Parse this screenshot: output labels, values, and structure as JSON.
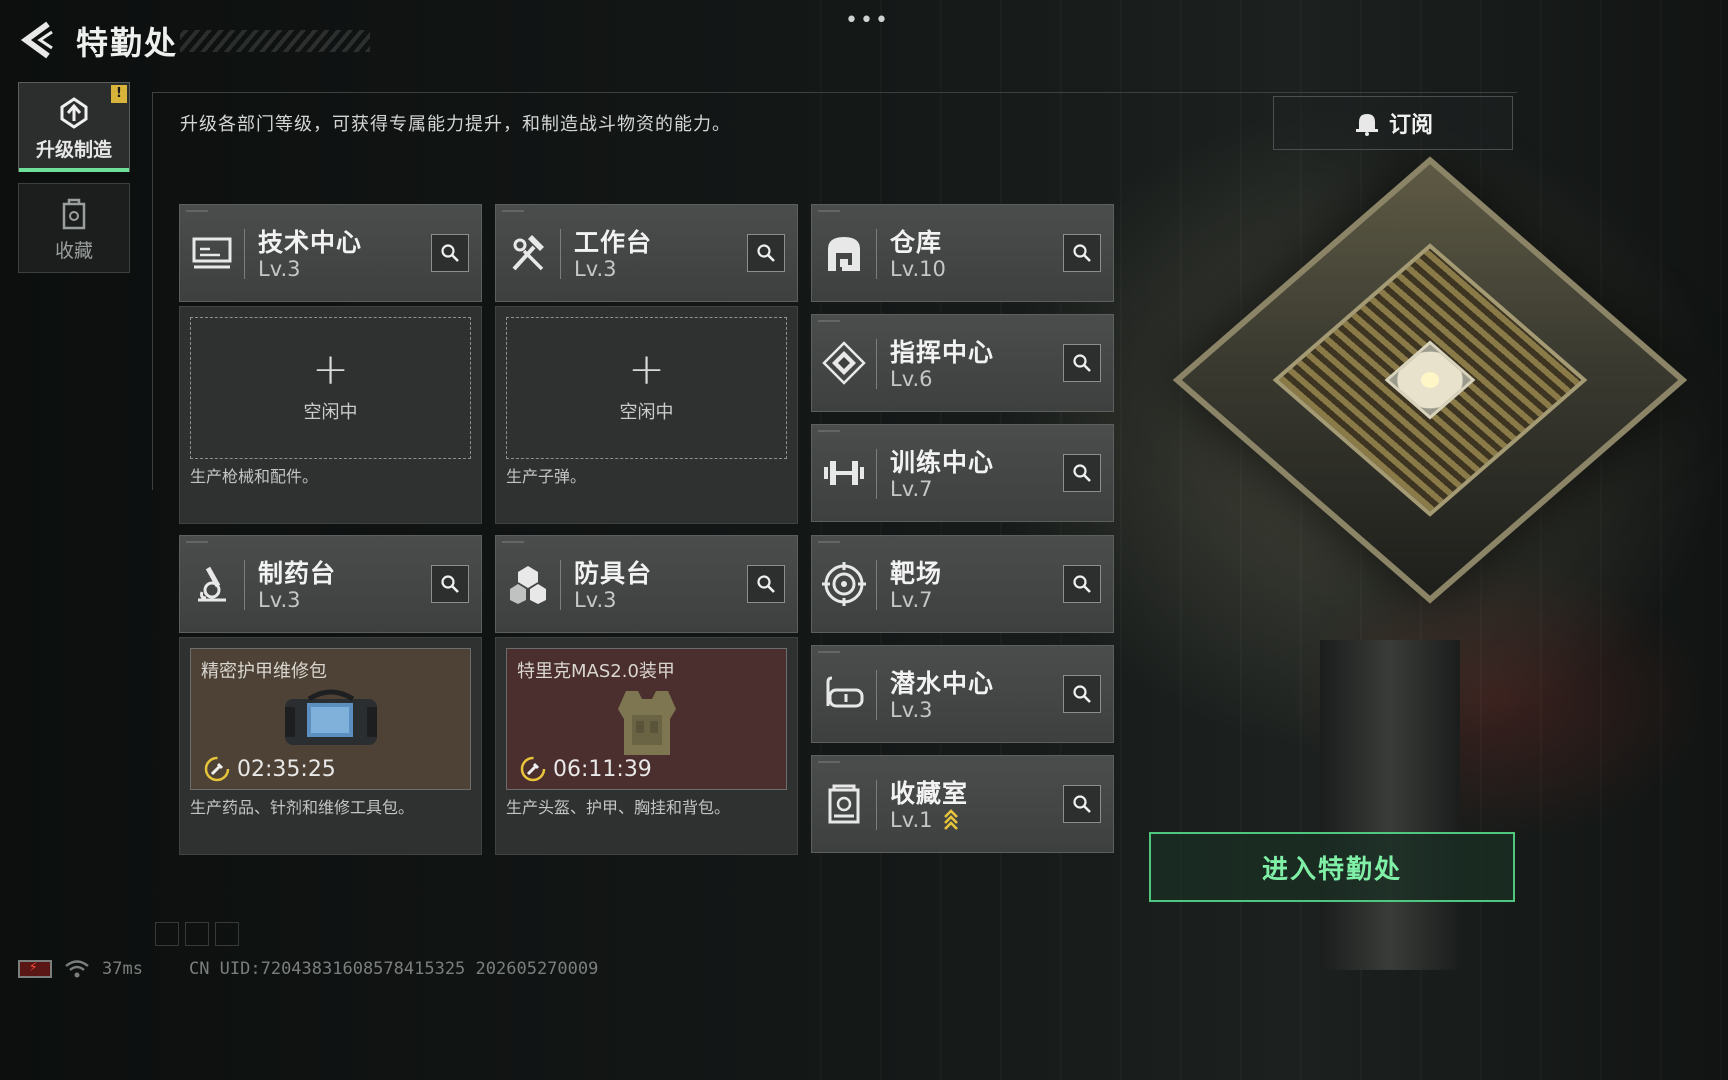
{
  "header": {
    "title": "特勤处",
    "menu_dots": "•••"
  },
  "sidebar": {
    "items": [
      {
        "label": "升级制造",
        "icon": "upgrade-gear-icon",
        "active": true,
        "alert": "!"
      },
      {
        "label": "收藏",
        "icon": "collection-case-icon",
        "active": false
      }
    ]
  },
  "description": "升级各部门等级，可获得专属能力提升，和制造战斗物资的能力。",
  "subscribe": {
    "label": "订阅",
    "icon": "bell-icon"
  },
  "departments": {
    "tech": {
      "name": "技术中心",
      "level": "Lv.3",
      "icon": "computer-icon",
      "slot_status": "空闲中",
      "plus": "+",
      "desc": "生产枪械和配件。"
    },
    "workbench": {
      "name": "工作台",
      "level": "Lv.3",
      "icon": "hammer-wrench-icon",
      "slot_status": "空闲中",
      "plus": "+",
      "desc": "生产子弹。"
    },
    "pharmacy": {
      "name": "制药台",
      "level": "Lv.3",
      "icon": "microscope-icon",
      "product": "精密护甲维修包",
      "timer": "02:35:25",
      "desc": "生产药品、针剂和维修工具包。",
      "slot_color": "#4d4235"
    },
    "armor": {
      "name": "防具台",
      "level": "Lv.3",
      "icon": "armor-plates-icon",
      "product": "特里克MAS2.0装甲",
      "timer": "06:11:39",
      "desc": "生产头盔、护甲、胸挂和背包。",
      "slot_color": "#4b2e2e"
    },
    "warehouse": {
      "name": "仓库",
      "level": "Lv.10",
      "icon": "warehouse-icon"
    },
    "command": {
      "name": "指挥中心",
      "level": "Lv.6",
      "icon": "command-diamond-icon"
    },
    "training": {
      "name": "训练中心",
      "level": "Lv.7",
      "icon": "dumbbell-icon"
    },
    "range": {
      "name": "靶场",
      "level": "Lv.7",
      "icon": "target-icon"
    },
    "diving": {
      "name": "潜水中心",
      "level": "Lv.3",
      "icon": "diving-mask-icon"
    },
    "collection": {
      "name": "收藏室",
      "level": "Lv.1",
      "icon": "collection-room-icon",
      "upgrade_arrow": true
    }
  },
  "enter_button": {
    "label": "进入特勤处"
  },
  "status": {
    "ping": "37ms",
    "uid": "CN UID:72043831608578415325 202605270009"
  },
  "colors": {
    "accent_green": "#6fe09a",
    "alert_yellow": "#d9b43a",
    "upgrade_yellow": "#e7c43a"
  }
}
